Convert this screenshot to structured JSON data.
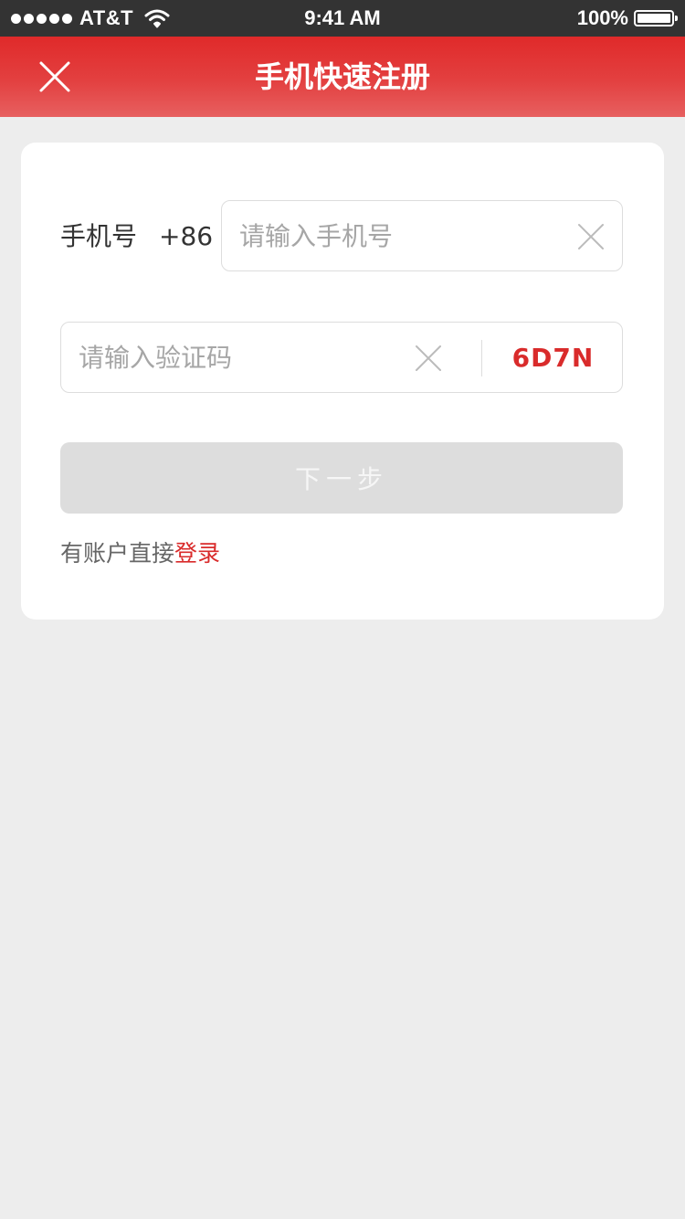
{
  "status_bar": {
    "carrier": "AT&T",
    "time": "9:41 AM",
    "battery": "100%",
    "signal_icon": "signal-dots-icon",
    "wifi_icon": "wifi-icon",
    "battery_icon": "battery-icon",
    "battery_level": 1.0
  },
  "nav": {
    "title": "手机快速注册",
    "close_icon": "close-icon",
    "colors": {
      "top": "#e02a2a",
      "bottom": "#e76060"
    }
  },
  "form": {
    "phone_label": "手机号",
    "country_code": "+86",
    "phone_placeholder": "请输入手机号",
    "phone_value": "",
    "code_placeholder": "请输入验证码",
    "code_value": "",
    "captcha_text": "6D7N",
    "clear_icon": "clear-icon",
    "next_label": "下一步",
    "next_enabled": false,
    "login_prompt": "有账户直接",
    "login_link": "登录"
  },
  "colors": {
    "accent": "#d92b2b",
    "background": "#ededed",
    "card": "#ffffff",
    "disabled_button": "#dddddd"
  }
}
